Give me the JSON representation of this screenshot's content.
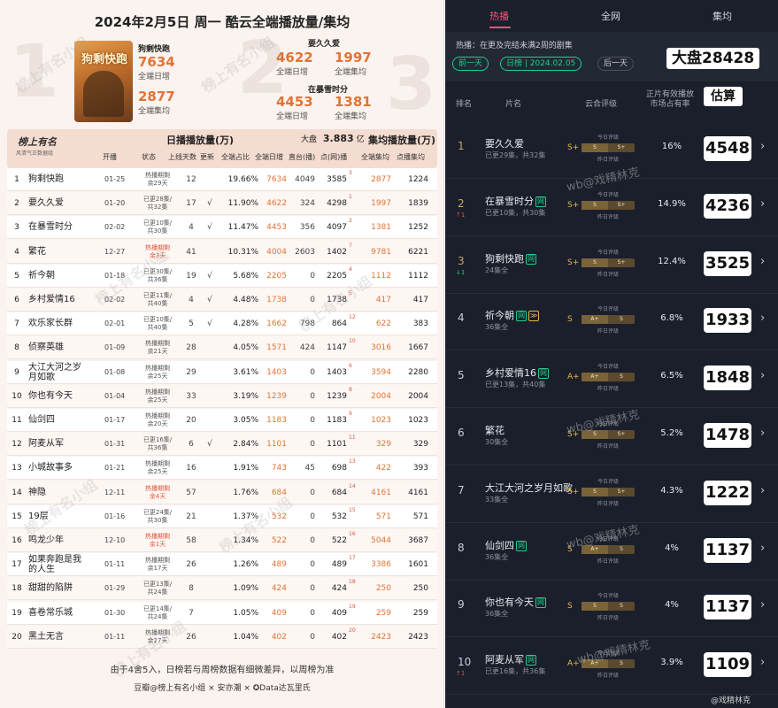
{
  "left": {
    "title": "2024年2月5日 周一 酷云全端播放量/集均",
    "hero": {
      "first": {
        "name": "狗剩快跑",
        "daily": "7634",
        "daily_label": "全端日增",
        "avg": "2877",
        "avg_label": "全端集均"
      },
      "second": {
        "name": "要久久爱",
        "daily": "4622",
        "daily_label": "全端日增",
        "avg": "1997",
        "avg_label": "全端集均"
      },
      "third": {
        "name": "在暴雪时分",
        "daily": "4453",
        "daily_label": "全端日增",
        "avg": "1381",
        "avg_label": "全端集均"
      },
      "big_numbers": [
        "1",
        "2",
        "3"
      ],
      "poster_title": "狗剩快跑"
    },
    "table_header": {
      "logo": "榜上有名",
      "logo_sub": "风清气正数据组",
      "daily_group": "日播播放量(万)",
      "market_label": "大盘",
      "market_value": "3.883",
      "market_unit": "亿",
      "total_group": "集均播放量(万)",
      "columns": [
        "开播",
        "状态",
        "上线天数",
        "更新",
        "全端占比",
        "全端日增",
        "直台(播)",
        "点(网)播",
        "全端集均",
        "点播集均"
      ]
    },
    "rows": [
      {
        "rank": "1",
        "name": "狗剩快跑",
        "date": "01-25",
        "state": "热播期剩\n余29天",
        "hot": false,
        "days": "12",
        "upd": "",
        "share": "19.66%",
        "all": "7634",
        "tv": "4049",
        "net": "3585",
        "rk2": "3",
        "tot": "2877",
        "tot2": "1224"
      },
      {
        "rank": "2",
        "name": "要久久爱",
        "date": "01-20",
        "state": "已更28集/\n共32集",
        "hot": false,
        "days": "17",
        "upd": "√",
        "share": "11.90%",
        "all": "4622",
        "tv": "324",
        "net": "4298",
        "rk2": "1",
        "tot": "1997",
        "tot2": "1839"
      },
      {
        "rank": "3",
        "name": "在暴雪时分",
        "date": "02-02",
        "state": "已更10集/\n共30集",
        "hot": false,
        "days": "4",
        "upd": "√",
        "share": "11.47%",
        "all": "4453",
        "tv": "356",
        "net": "4097",
        "rk2": "2",
        "tot": "1381",
        "tot2": "1252"
      },
      {
        "rank": "4",
        "name": "繁花",
        "date": "12-27",
        "state": "热播期剩\n余3天",
        "hot": true,
        "days": "41",
        "upd": "",
        "share": "10.31%",
        "all": "4004",
        "tv": "2603",
        "net": "1402",
        "rk2": "7",
        "tot": "9781",
        "tot2": "6221"
      },
      {
        "rank": "5",
        "name": "祈今朝",
        "date": "01-18",
        "state": "已更30集/\n共36集",
        "hot": false,
        "days": "19",
        "upd": "√",
        "share": "5.68%",
        "all": "2205",
        "tv": "0",
        "net": "2205",
        "rk2": "4",
        "tot": "1112",
        "tot2": "1112"
      },
      {
        "rank": "6",
        "name": "乡村爱情16",
        "date": "02-02",
        "state": "已更11集/\n共40集",
        "hot": false,
        "days": "4",
        "upd": "√",
        "share": "4.48%",
        "all": "1738",
        "tv": "0",
        "net": "1738",
        "rk2": "5",
        "tot": "417",
        "tot2": "417"
      },
      {
        "rank": "7",
        "name": "欢乐家长群",
        "date": "02-01",
        "state": "已更10集/\n共40集",
        "hot": false,
        "days": "5",
        "upd": "√",
        "share": "4.28%",
        "all": "1662",
        "tv": "798",
        "net": "864",
        "rk2": "12",
        "tot": "622",
        "tot2": "383"
      },
      {
        "rank": "8",
        "name": "侦察英雄",
        "date": "01-09",
        "state": "热播期剩\n余21天",
        "hot": false,
        "days": "28",
        "upd": "",
        "share": "4.05%",
        "all": "1571",
        "tv": "424",
        "net": "1147",
        "rk2": "10",
        "tot": "3016",
        "tot2": "1667"
      },
      {
        "rank": "9",
        "name": "大江大河之岁月如歌",
        "date": "01-08",
        "state": "热播期剩\n余25天",
        "hot": false,
        "days": "29",
        "upd": "",
        "share": "3.61%",
        "all": "1403",
        "tv": "0",
        "net": "1403",
        "rk2": "6",
        "tot": "3594",
        "tot2": "2280"
      },
      {
        "rank": "10",
        "name": "你也有今天",
        "date": "01-04",
        "state": "热播期剩\n余25天",
        "hot": false,
        "days": "33",
        "upd": "",
        "share": "3.19%",
        "all": "1239",
        "tv": "0",
        "net": "1239",
        "rk2": "8",
        "tot": "2004",
        "tot2": "2004"
      },
      {
        "rank": "11",
        "name": "仙剑四",
        "date": "01-17",
        "state": "热播期剩\n余20天",
        "hot": false,
        "days": "20",
        "upd": "",
        "share": "3.05%",
        "all": "1183",
        "tv": "0",
        "net": "1183",
        "rk2": "9",
        "tot": "1023",
        "tot2": "1023"
      },
      {
        "rank": "12",
        "name": "阿麦从军",
        "date": "01-31",
        "state": "已更16集/\n共36集",
        "hot": false,
        "days": "6",
        "upd": "√",
        "share": "2.84%",
        "all": "1101",
        "tv": "0",
        "net": "1101",
        "rk2": "11",
        "tot": "329",
        "tot2": "329"
      },
      {
        "rank": "13",
        "name": "小城故事多",
        "date": "01-21",
        "state": "热播期剩\n余25天",
        "hot": false,
        "days": "16",
        "upd": "",
        "share": "1.91%",
        "all": "743",
        "tv": "45",
        "net": "698",
        "rk2": "13",
        "tot": "422",
        "tot2": "393"
      },
      {
        "rank": "14",
        "name": "神隐",
        "date": "12-11",
        "state": "热播期剩\n余4天",
        "hot": true,
        "days": "57",
        "upd": "",
        "share": "1.76%",
        "all": "684",
        "tv": "0",
        "net": "684",
        "rk2": "14",
        "tot": "4161",
        "tot2": "4161"
      },
      {
        "rank": "15",
        "name": "19层",
        "date": "01-16",
        "state": "已更24集/\n共30集",
        "hot": false,
        "days": "21",
        "upd": "",
        "share": "1.37%",
        "all": "532",
        "tv": "0",
        "net": "532",
        "rk2": "15",
        "tot": "571",
        "tot2": "571"
      },
      {
        "rank": "16",
        "name": "鸣龙少年",
        "date": "12-10",
        "state": "热播期剩\n余1天",
        "hot": true,
        "days": "58",
        "upd": "",
        "share": "1.34%",
        "all": "522",
        "tv": "0",
        "net": "522",
        "rk2": "16",
        "tot": "5044",
        "tot2": "3687"
      },
      {
        "rank": "17",
        "name": "如果奔跑是我的人生",
        "date": "01-11",
        "state": "热播期剩\n余17天",
        "hot": false,
        "days": "26",
        "upd": "",
        "share": "1.26%",
        "all": "489",
        "tv": "0",
        "net": "489",
        "rk2": "17",
        "tot": "3386",
        "tot2": "1601"
      },
      {
        "rank": "18",
        "name": "甜甜的陷阱",
        "date": "01-29",
        "state": "已更13集/\n共24集",
        "hot": false,
        "days": "8",
        "upd": "",
        "share": "1.09%",
        "all": "424",
        "tv": "0",
        "net": "424",
        "rk2": "18",
        "tot": "250",
        "tot2": "250"
      },
      {
        "rank": "19",
        "name": "喜卷常乐城",
        "date": "01-30",
        "state": "已更14集/\n共24集",
        "hot": false,
        "days": "7",
        "upd": "",
        "share": "1.05%",
        "all": "409",
        "tv": "0",
        "net": "409",
        "rk2": "19",
        "tot": "259",
        "tot2": "259"
      },
      {
        "rank": "20",
        "name": "黑土无言",
        "date": "01-11",
        "state": "热播期剩\n余27天",
        "hot": false,
        "days": "26",
        "upd": "",
        "share": "1.04%",
        "all": "402",
        "tv": "0",
        "net": "402",
        "rk2": "20",
        "tot": "2423",
        "tot2": "2423"
      }
    ],
    "footer": "由于4舍5入，日榜若与周榜数据有细微差异，以周榜为准",
    "credit": "豆瓣@榜上有名小组 × 安亦潮 × ✪Data达瓦里氏",
    "watermark": "榜上有名小组"
  },
  "right": {
    "tabs": [
      "热播",
      "全网",
      "集均"
    ],
    "note": "热播：在更及完结未满2周的剧集",
    "prev_day": "前一天",
    "day_rank": "日榜 | 2024.02.05",
    "next_day": "后一天",
    "dapan": "大盘28428",
    "headers": {
      "rank": "排名",
      "title": "片名",
      "grade": "云合评级",
      "share": "正片有效播放\n市场占有率",
      "estimate": "估算"
    },
    "grade_top_label": "今日评级",
    "grade_bottom_label": "昨日评级",
    "items": [
      {
        "rank": "1",
        "trend": "",
        "trend_dir": "",
        "title": "要久久爱",
        "net": false,
        "vip": false,
        "sub": "已更29集，共32集",
        "grade": "S+",
        "g1": "S",
        "g2": "S+",
        "share": "16%",
        "est": "4548"
      },
      {
        "rank": "2",
        "trend": "↑1",
        "trend_dir": "up",
        "title": "在暴雪时分",
        "net": true,
        "vip": false,
        "sub": "已更10集，共30集",
        "grade": "S+",
        "g1": "S",
        "g2": "S+",
        "share": "14.9%",
        "est": "4236"
      },
      {
        "rank": "3",
        "trend": "↓1",
        "trend_dir": "down",
        "title": "狗剩快跑",
        "net": true,
        "vip": false,
        "sub": "24集全",
        "grade": "S+",
        "g1": "S",
        "g2": "S+",
        "share": "12.4%",
        "est": "3525"
      },
      {
        "rank": "4",
        "trend": "",
        "trend_dir": "",
        "title": "祈今朝",
        "net": true,
        "vip": true,
        "sub": "36集全",
        "grade": "S",
        "g1": "A+",
        "g2": "S",
        "share": "6.8%",
        "est": "1933"
      },
      {
        "rank": "5",
        "trend": "",
        "trend_dir": "",
        "title": "乡村爱情16",
        "net": true,
        "vip": false,
        "sub": "已更13集，共40集",
        "grade": "A+",
        "g1": "A+",
        "g2": "S",
        "share": "6.5%",
        "est": "1848"
      },
      {
        "rank": "6",
        "trend": "",
        "trend_dir": "",
        "title": "繁花",
        "net": false,
        "vip": false,
        "sub": "30集全",
        "grade": "S+",
        "g1": "S",
        "g2": "S+",
        "share": "5.2%",
        "est": "1478"
      },
      {
        "rank": "7",
        "trend": "",
        "trend_dir": "",
        "title": "大江大河之岁月如歌",
        "net": false,
        "vip": false,
        "sub": "33集全",
        "grade": "S+",
        "g1": "S",
        "g2": "S+",
        "share": "4.3%",
        "est": "1222"
      },
      {
        "rank": "8",
        "trend": "",
        "trend_dir": "",
        "title": "仙剑四",
        "net": true,
        "vip": false,
        "sub": "36集全",
        "grade": "S",
        "g1": "A+",
        "g2": "S",
        "share": "4%",
        "est": "1137"
      },
      {
        "rank": "9",
        "trend": "",
        "trend_dir": "",
        "title": "你也有今天",
        "net": true,
        "vip": false,
        "sub": "36集全",
        "grade": "S",
        "g1": "S",
        "g2": "S",
        "share": "4%",
        "est": "1137"
      },
      {
        "rank": "10",
        "trend": "↑1",
        "trend_dir": "up",
        "title": "阿麦从军",
        "net": true,
        "vip": false,
        "sub": "已更16集，共36集",
        "grade": "A+",
        "g1": "A+",
        "g2": "S",
        "share": "3.9%",
        "est": "1109"
      }
    ],
    "watermark": "wb@戏精林克",
    "bottom_credit": "@戏精林克",
    "net_badge": "网",
    "vip_badge": "≫",
    "chevron": "›"
  }
}
